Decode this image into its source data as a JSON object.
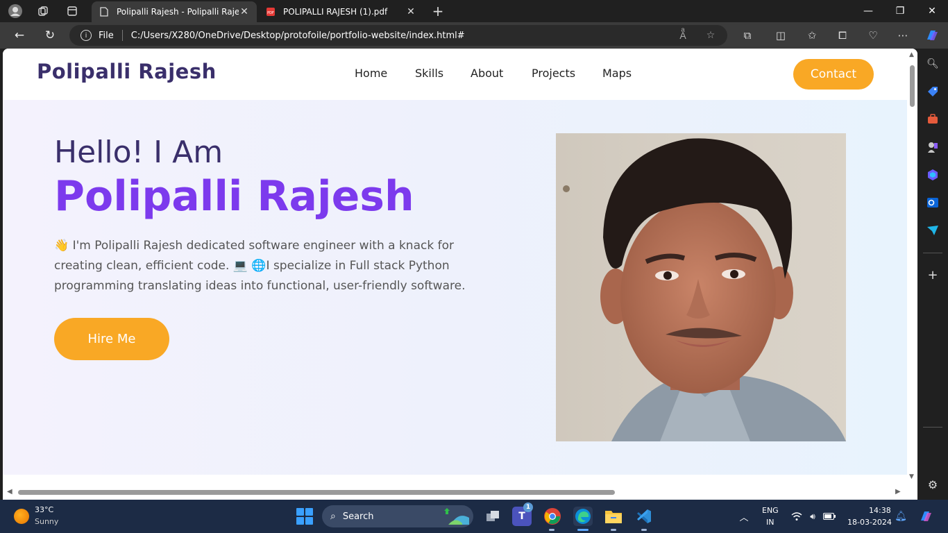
{
  "browser": {
    "tabs": [
      {
        "title": "Polipalli Rajesh - Polipalli Rajesh",
        "active": true
      },
      {
        "title": "POLIPALLI RAJESH (1).pdf",
        "active": false
      }
    ],
    "address": {
      "scheme_label": "File",
      "url": "C:/Users/X280/OneDrive/Desktop/protofoile/portfolio-website/index.html#"
    },
    "window_controls": {
      "minimize": "—",
      "restore": "❐",
      "close": "✕"
    }
  },
  "site": {
    "logo": "Polipalli Rajesh",
    "nav": [
      "Home",
      "Skills",
      "About",
      "Projects",
      "Maps"
    ],
    "contact_label": "Contact",
    "hero": {
      "greeting": "Hello! I Am",
      "name": "Polipalli Rajesh",
      "description": "👋 I'm Polipalli Rajesh dedicated software engineer with a knack for creating clean, efficient code. 💻 🌐I specialize in Full stack Python programming translating ideas into functional, user-friendly software.",
      "hire_label": "Hire Me"
    },
    "colors": {
      "accent_orange": "#f9a825",
      "accent_purple": "#7c3aed",
      "dark_navy": "#3a2f6b"
    }
  },
  "taskbar": {
    "weather_temp": "33°C",
    "weather_condition": "Sunny",
    "search_label": "Search",
    "teams_badge": "1",
    "language_line1": "ENG",
    "language_line2": "IN",
    "time": "14:38",
    "date": "18-03-2024"
  }
}
